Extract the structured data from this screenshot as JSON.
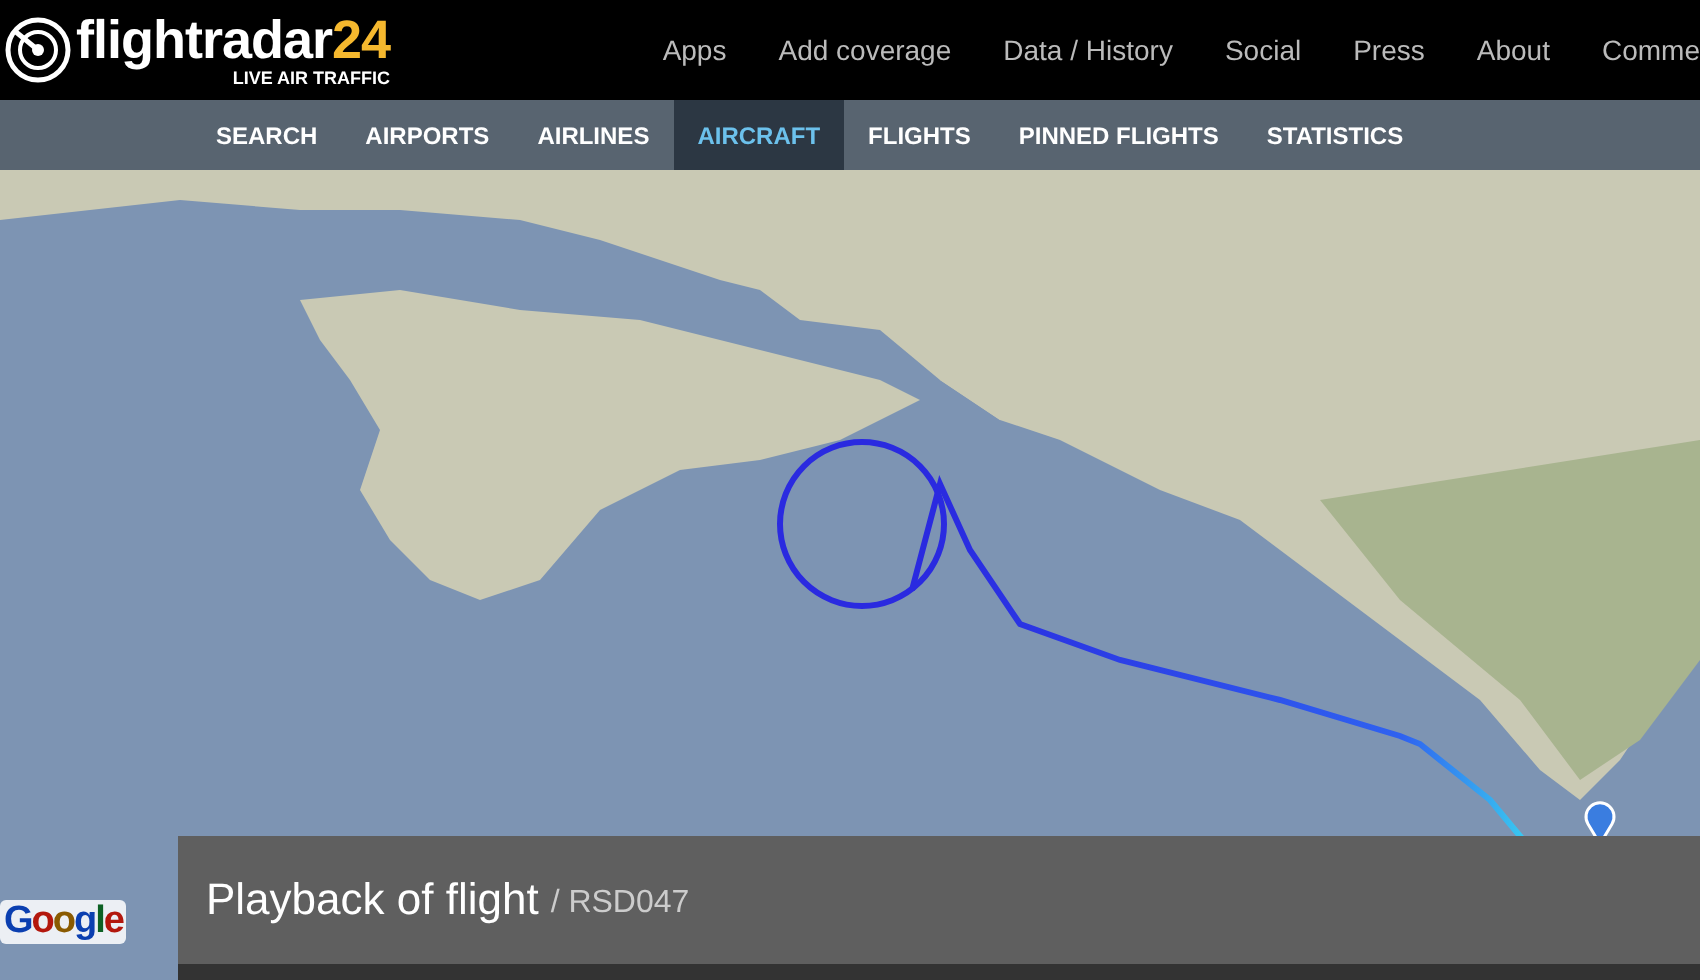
{
  "logo": {
    "name": "flightradar",
    "number": "24",
    "tagline": "LIVE AIR TRAFFIC"
  },
  "top_nav": [
    "Apps",
    "Add coverage",
    "Data / History",
    "Social",
    "Press",
    "About",
    "Comme"
  ],
  "tabs": [
    {
      "label": "SEARCH",
      "selected": false
    },
    {
      "label": "AIRPORTS",
      "selected": false
    },
    {
      "label": "AIRLINES",
      "selected": false
    },
    {
      "label": "AIRCRAFT",
      "selected": true
    },
    {
      "label": "FLIGHTS",
      "selected": false
    },
    {
      "label": "PINNED FLIGHTS",
      "selected": false
    },
    {
      "label": "STATISTICS",
      "selected": false
    }
  ],
  "map_attribution": "Google",
  "playback": {
    "title": "Playback of flight",
    "flight": "/ RSD047"
  }
}
